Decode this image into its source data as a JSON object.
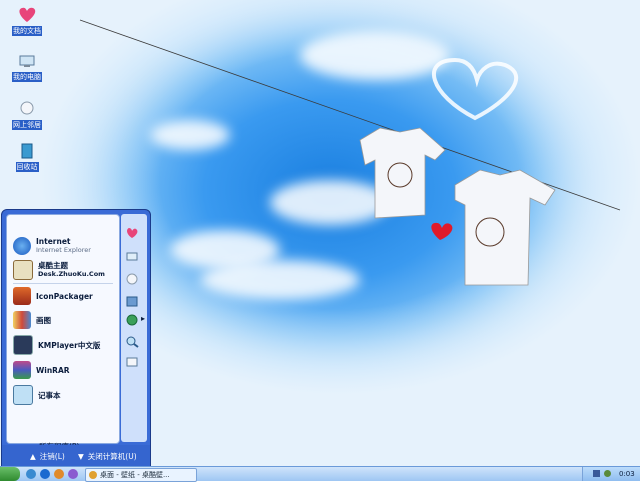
{
  "desktop": {
    "icons": [
      {
        "label": "我的文档",
        "icon": "my-documents-heart-icon"
      },
      {
        "label": "我的电脑",
        "icon": "my-computer-icon"
      },
      {
        "label": "网上邻居",
        "icon": "network-places-icon"
      },
      {
        "label": "回收站",
        "icon": "recycle-bin-icon"
      }
    ]
  },
  "start_menu": {
    "pinned": [
      {
        "title": "Internet",
        "subtitle": "Internet Explorer",
        "icon": "internet-explorer-icon"
      },
      {
        "title": "桌酷主题",
        "subtitle": "Desk.ZhuoKu.Com",
        "icon": "zhuoku-theme-icon"
      }
    ],
    "recent": [
      {
        "title": "IconPackager",
        "icon": "iconpackager-icon"
      },
      {
        "title": "画图",
        "icon": "paint-icon"
      },
      {
        "title": "KMPlayer中文版",
        "icon": "kmplayer-icon"
      },
      {
        "title": "WinRAR",
        "icon": "winrar-icon"
      },
      {
        "title": "记事本",
        "icon": "notepad-icon"
      }
    ],
    "all_programs": "所有程序(P)",
    "logoff": "注销(L)",
    "shutdown": "关闭计算机(U)"
  },
  "taskbar": {
    "task_button": "桌面 - 壁纸 - 桌酷壁...",
    "clock": "0:03"
  },
  "colors": {
    "accent": "#3a6bd6",
    "sky": "#3a9af0"
  }
}
